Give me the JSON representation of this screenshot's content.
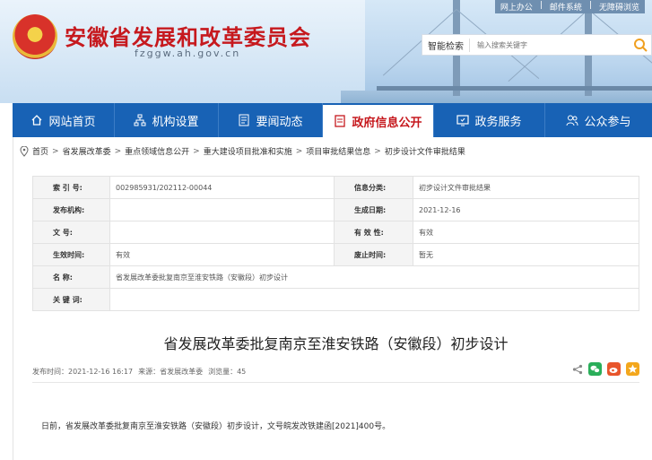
{
  "header": {
    "top_links": [
      "网上办公",
      "|",
      "邮件系统",
      "|",
      "无障碍浏览"
    ],
    "site_title": "安徽省发展和改革委员会",
    "site_domain": "fzggw.ah.gov.cn",
    "search_label": "智能检索",
    "search_placeholder": "输入搜索关键字"
  },
  "nav": {
    "items": [
      {
        "label": "网站首页",
        "icon": "home-icon"
      },
      {
        "label": "机构设置",
        "icon": "org-chart-icon"
      },
      {
        "label": "要闻动态",
        "icon": "news-icon"
      },
      {
        "label": "政府信息公开",
        "icon": "doc-icon"
      },
      {
        "label": "政务服务",
        "icon": "service-icon"
      },
      {
        "label": "公众参与",
        "icon": "people-icon"
      }
    ],
    "active_index": 3
  },
  "breadcrumb": {
    "items": [
      "首页",
      "省发展改革委",
      "重点领域信息公开",
      "重大建设项目批准和实施",
      "项目审批结果信息",
      "初步设计文件审批结果"
    ],
    "separator": ">"
  },
  "info": {
    "index_label": "索 引 号:",
    "index_value": "002985931/202112-00044",
    "category_label": "信息分类:",
    "category_value": "初步设计文件审批结果",
    "publisher_label": "发布机构:",
    "publisher_value": "",
    "date_label": "生成日期:",
    "date_value": "2021-12-16",
    "docno_label": "文 号:",
    "docno_value": "",
    "validity_label": "有 效 性:",
    "validity_value": "有效",
    "effective_label": "生效时间:",
    "effective_value": "有效",
    "repeal_label": "废止时间:",
    "repeal_value": "暂无",
    "name_label": "名 称:",
    "name_value": "省发展改革委批复南京至淮安铁路（安徽段）初步设计",
    "keywords_label": "关 键 词:",
    "keywords_value": ""
  },
  "article": {
    "title": "省发展改革委批复南京至淮安铁路（安徽段）初步设计",
    "meta_time": "发布时间：2021-12-16 16:17",
    "meta_source": "来源：省发展改革委",
    "meta_views": "浏览量：45",
    "body": "日前，省发展改革委批复南京至淮安铁路（安徽段）初步设计，文号皖发改铁建函[2021]400号。"
  },
  "colors": {
    "nav_blue": "#1862b5",
    "title_red": "#c6191e",
    "wechat_green": "#2aae5a",
    "weibo_orange": "#e8552b",
    "qzone_yellow": "#f3a71d"
  }
}
